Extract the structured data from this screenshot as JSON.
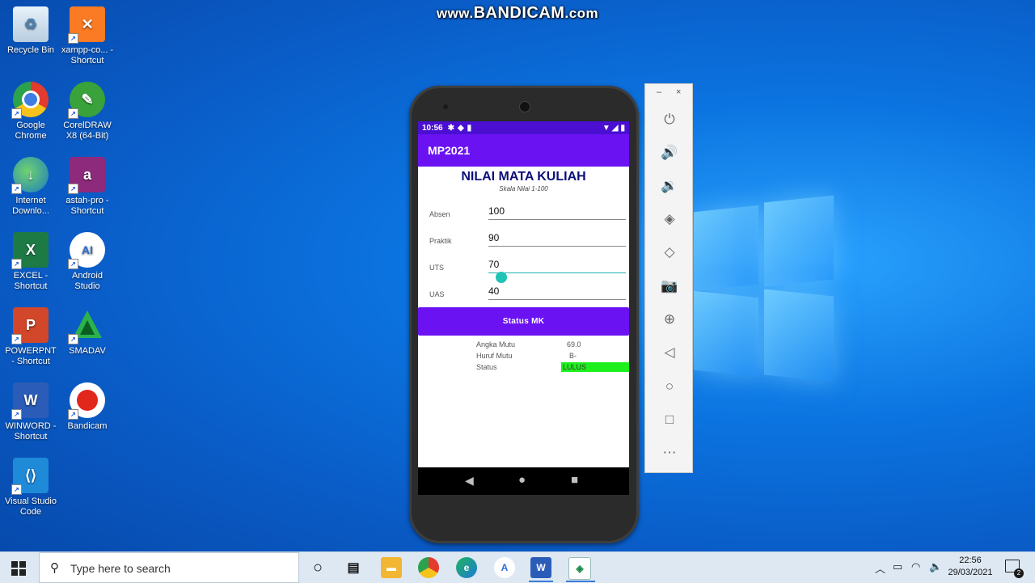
{
  "watermark": {
    "prefix": "www.",
    "brand": "BANDICAM",
    "suffix": ".com"
  },
  "desktop_icons": [
    {
      "label": "Recycle Bin"
    },
    {
      "label": "xampp-co... - Shortcut"
    },
    {
      "label": "Google Chrome"
    },
    {
      "label": "CorelDRAW X8 (64-Bit)"
    },
    {
      "label": "Internet Downlo..."
    },
    {
      "label": "astah-pro - Shortcut"
    },
    {
      "label": "EXCEL - Shortcut"
    },
    {
      "label": "Android Studio"
    },
    {
      "label": "POWERPNT - Shortcut"
    },
    {
      "label": "SMADAV"
    },
    {
      "label": "WINWORD - Shortcut"
    },
    {
      "label": "Bandicam"
    },
    {
      "label": "Visual Studio Code"
    }
  ],
  "phone": {
    "status_time": "10:56",
    "app_title": "MP2021",
    "heading": "NILAI MATA KULIAH",
    "subheading": "Skala Nilai 1-100",
    "fields": [
      {
        "label": "Absen",
        "value": "100"
      },
      {
        "label": "Praktik",
        "value": "90"
      },
      {
        "label": "UTS",
        "value": "70"
      },
      {
        "label": "UAS",
        "value": "40"
      }
    ],
    "button_label": "Status MK",
    "results": [
      {
        "key": "Angka Mutu",
        "value": "69.0"
      },
      {
        "key": "Huruf Mutu",
        "value": "B-"
      },
      {
        "key": "Status",
        "value": "LULUS"
      }
    ],
    "status_color": "#1ef01e",
    "accent_color": "#6a12f2"
  },
  "emulator_toolbar": {
    "minimize": "–",
    "close": "×",
    "tools": [
      "power-icon",
      "volume-up-icon",
      "volume-down-icon",
      "rotate-left-icon",
      "rotate-right-icon",
      "camera-icon",
      "zoom-icon",
      "back-icon",
      "home-icon",
      "overview-icon",
      "more-icon"
    ]
  },
  "taskbar": {
    "search_placeholder": "Type here to search",
    "time": "22:56",
    "date": "29/03/2021",
    "notification_count": "2"
  }
}
